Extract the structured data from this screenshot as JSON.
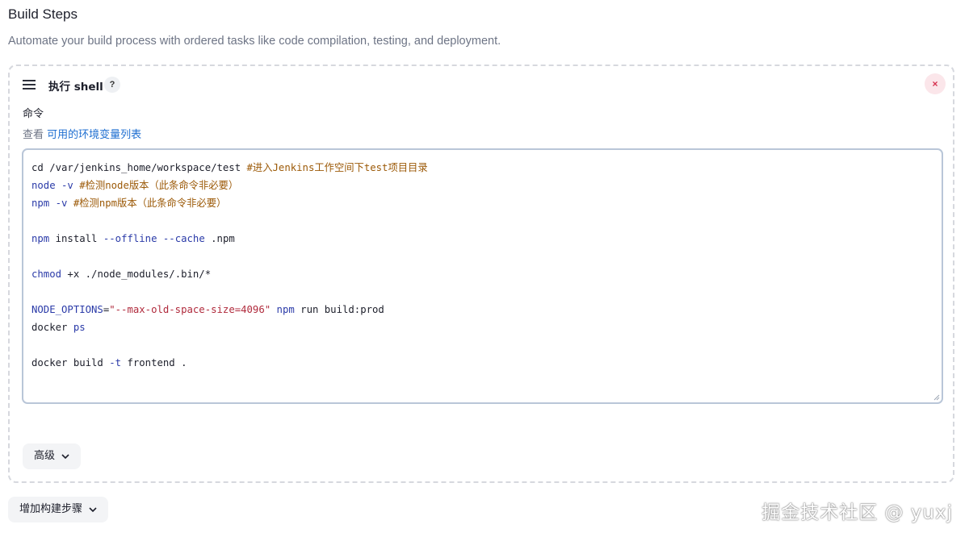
{
  "section": {
    "title": "Build Steps",
    "description": "Automate your build process with ordered tasks like code compilation, testing, and deployment."
  },
  "step": {
    "title": "执行 shell",
    "help_label": "?",
    "delete_label": "×",
    "field_label": "命令",
    "env_prefix": "查看 ",
    "env_link": "可用的环境变量列表",
    "command_lines": [
      [
        {
          "t": "cd /var/jenkins_home/workspace/test ",
          "c": ""
        },
        {
          "t": "#进入Jenkins工作空间下test项目目录",
          "c": "cm"
        }
      ],
      [
        {
          "t": "node",
          "c": "kw"
        },
        {
          "t": " ",
          "c": ""
        },
        {
          "t": "-v",
          "c": "kw"
        },
        {
          "t": " ",
          "c": ""
        },
        {
          "t": "#检测node版本（此条命令非必要）",
          "c": "cm"
        }
      ],
      [
        {
          "t": "npm",
          "c": "kw"
        },
        {
          "t": " ",
          "c": ""
        },
        {
          "t": "-v",
          "c": "kw"
        },
        {
          "t": " ",
          "c": ""
        },
        {
          "t": "#检测npm版本（此条命令非必要）",
          "c": "cm"
        }
      ],
      [],
      [
        {
          "t": "npm",
          "c": "kw"
        },
        {
          "t": " install ",
          "c": ""
        },
        {
          "t": "--offline",
          "c": "kw"
        },
        {
          "t": " ",
          "c": ""
        },
        {
          "t": "--cache",
          "c": "kw"
        },
        {
          "t": " .npm",
          "c": ""
        }
      ],
      [],
      [
        {
          "t": "chmod",
          "c": "kw"
        },
        {
          "t": " +x ./node_modules/.bin/*",
          "c": ""
        }
      ],
      [],
      [
        {
          "t": "NODE_OPTIONS",
          "c": "kw"
        },
        {
          "t": "=",
          "c": ""
        },
        {
          "t": "\"--max-old-space-size=4096\"",
          "c": "st"
        },
        {
          "t": " ",
          "c": ""
        },
        {
          "t": "npm",
          "c": "kw"
        },
        {
          "t": " run build:prod",
          "c": ""
        }
      ],
      [
        {
          "t": "docker ",
          "c": ""
        },
        {
          "t": "ps",
          "c": "kw"
        }
      ],
      [],
      [
        {
          "t": "docker build ",
          "c": ""
        },
        {
          "t": "-t",
          "c": "kw"
        },
        {
          "t": " frontend .",
          "c": ""
        }
      ]
    ],
    "advanced_label": "高级"
  },
  "add_step_label": "增加构建步骤",
  "watermark": "掘金技术社区 @ yuxj",
  "colors": {
    "keyword": "#2a3aa8",
    "comment": "#9c5a08",
    "string": "#b02a3c",
    "link": "#1f6fd1",
    "delete_bg": "#fbe6ea",
    "delete_fg": "#d6304e"
  },
  "icons": {
    "drag": "drag-handle-icon",
    "help": "help-icon",
    "delete": "close-icon",
    "chevron": "chevron-down-icon"
  }
}
